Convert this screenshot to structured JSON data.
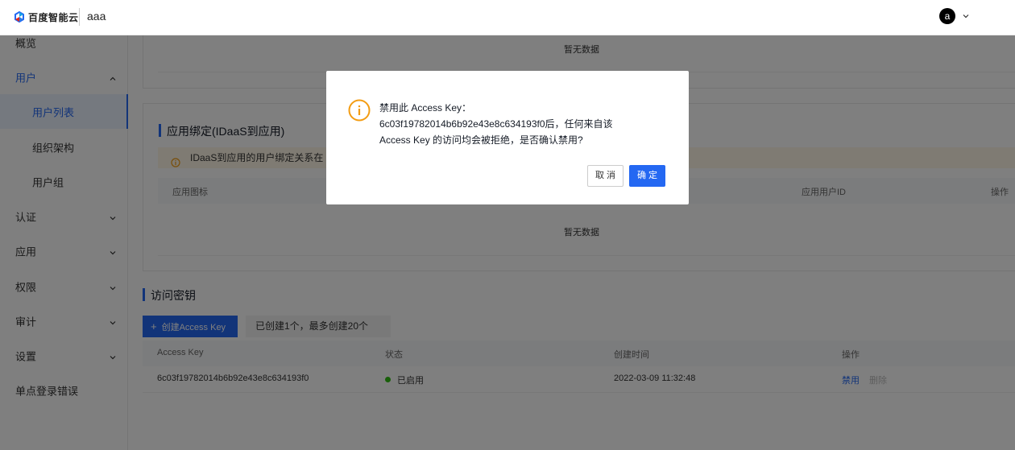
{
  "header": {
    "logo_text": "百度智能云",
    "tenant": "aaa",
    "avatar_letter": "a"
  },
  "sidebar": {
    "items": [
      {
        "label": "概览"
      },
      {
        "label": "用户",
        "expanded": true
      },
      {
        "label": "用户列表",
        "selected": true
      },
      {
        "label": "组织架构"
      },
      {
        "label": "用户组"
      },
      {
        "label": "认证"
      },
      {
        "label": "应用"
      },
      {
        "label": "权限"
      },
      {
        "label": "审计"
      },
      {
        "label": "设置"
      },
      {
        "label": "单点登录错误"
      }
    ]
  },
  "top_card": {
    "empty_text": "暂无数据"
  },
  "app_binding": {
    "title": "应用绑定(IDaaS到应用)",
    "notice": "IDaaS到应用的用户绑定关系在",
    "columns": [
      "应用图标",
      "应用用户ID",
      "操作"
    ],
    "empty_text": "暂无数据"
  },
  "access_keys": {
    "title": "访问密钥",
    "create_label": "创建Access Key",
    "quota_text": "已创建1个，最多创建20个",
    "columns": [
      "Access Key",
      "状态",
      "创建时间",
      "操作"
    ],
    "rows": [
      {
        "key": "6c03f19782014b6b92e43e8c634193f0",
        "status": "已启用",
        "created": "2022-03-09 11:32:48",
        "action_disable": "禁用",
        "action_delete": "删除"
      }
    ]
  },
  "modal": {
    "line1": "禁用此 Access Key：",
    "line2": "6c03f19782014b6b92e43e8c634193f0后，任何来自该",
    "line3": "Access Key 的访问均会被拒绝，是否确认禁用?",
    "cancel_label": "取 消",
    "ok_label": "确 定"
  },
  "colors": {
    "primary": "#2468f2",
    "warning": "#f39c12",
    "status_enabled": "#30bf13"
  }
}
